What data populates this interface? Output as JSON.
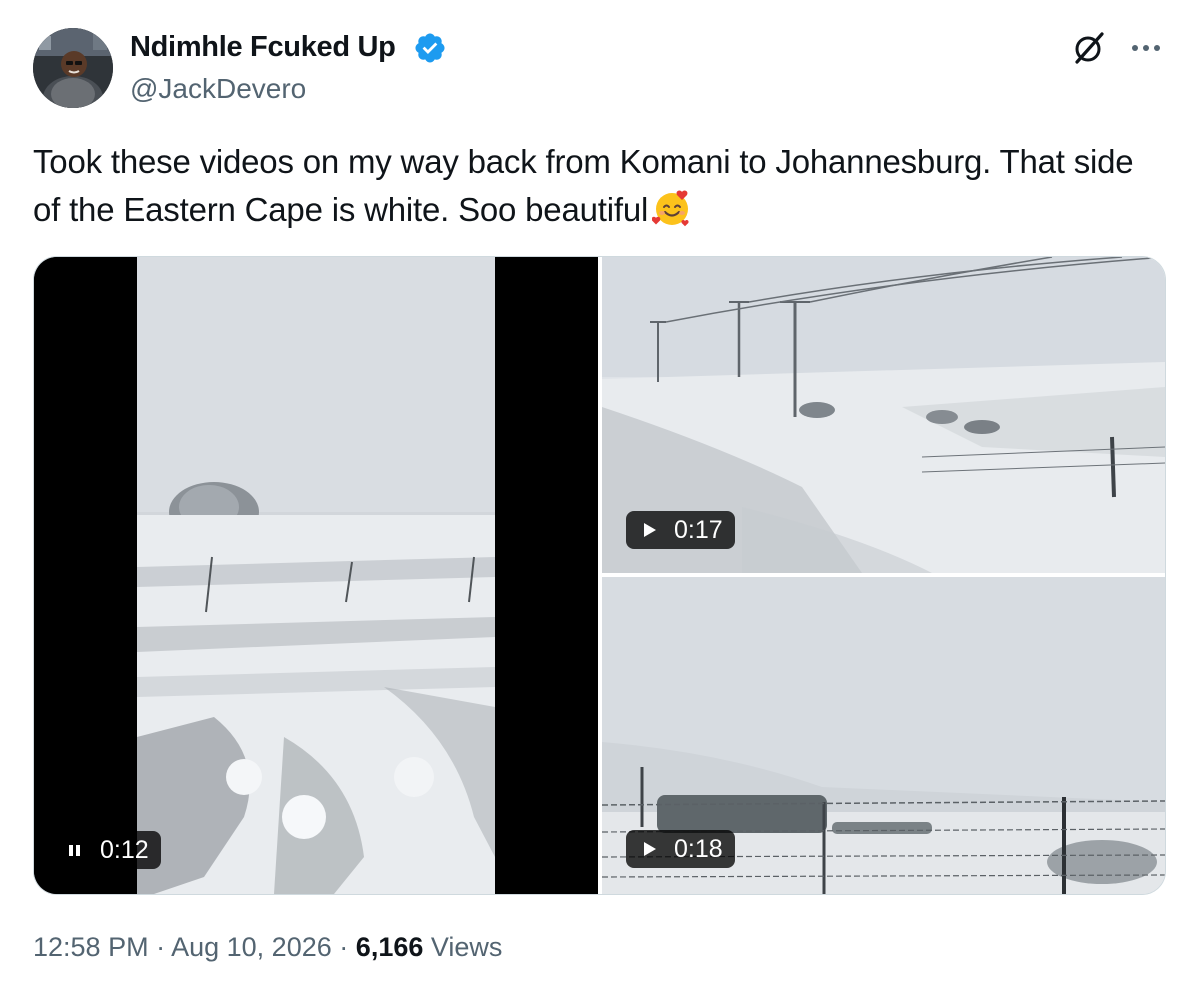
{
  "author": {
    "display_name": "Ndimhle Fcuked Up",
    "handle": "@JackDevero",
    "verified": true
  },
  "tweet": {
    "text": "Took these videos on my way back from Komani to Johannesburg. That side of the Eastern Cape is white. Soo beautiful",
    "emoji": "smiling-face-with-hearts"
  },
  "media": [
    {
      "kind": "video",
      "state": "playing",
      "control_icon": "pause-icon",
      "duration": "0:12"
    },
    {
      "kind": "video",
      "state": "paused",
      "control_icon": "play-icon",
      "duration": "0:17"
    },
    {
      "kind": "video",
      "state": "paused",
      "control_icon": "play-icon",
      "duration": "0:18"
    }
  ],
  "footer": {
    "time": "12:58 PM",
    "separator": "·",
    "date": "Aug 10, 2026",
    "views_count": "6,166",
    "views_label": "Views"
  },
  "colors": {
    "verified_blue": "#1d9bf0",
    "secondary_text": "#536471",
    "primary_text": "#0f1419"
  }
}
